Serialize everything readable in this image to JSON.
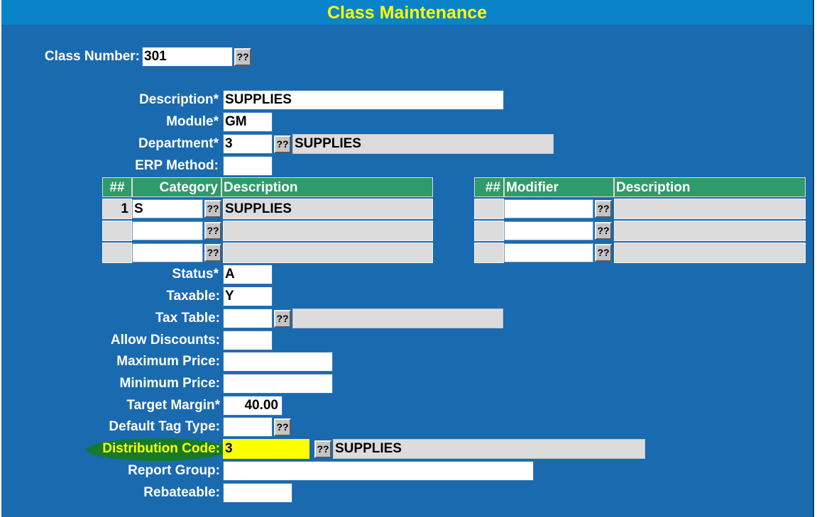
{
  "title": "Class Maintenance",
  "lookup_label": "??",
  "class_number": {
    "label": "Class Number:",
    "value": "301"
  },
  "description": {
    "label": "Description*",
    "value": "SUPPLIES"
  },
  "module": {
    "label": "Module*",
    "value": "GM"
  },
  "department": {
    "label": "Department*",
    "value": "3",
    "desc": "SUPPLIES"
  },
  "erp_method": {
    "label": "ERP Method:",
    "value": ""
  },
  "category_table": {
    "headers": {
      "num": "##",
      "category": "Category",
      "description": "Description"
    },
    "rows": [
      {
        "num": "1",
        "category": "S",
        "description": "SUPPLIES"
      },
      {
        "num": "",
        "category": "",
        "description": ""
      },
      {
        "num": "",
        "category": "",
        "description": ""
      }
    ]
  },
  "modifier_table": {
    "headers": {
      "num": "##",
      "modifier": "Modifier",
      "description": "Description"
    },
    "rows": [
      {
        "num": "",
        "modifier": "",
        "description": ""
      },
      {
        "num": "",
        "modifier": "",
        "description": ""
      },
      {
        "num": "",
        "modifier": "",
        "description": ""
      }
    ]
  },
  "status": {
    "label": "Status*",
    "value": "A"
  },
  "taxable": {
    "label": "Taxable:",
    "value": "Y"
  },
  "tax_table": {
    "label": "Tax Table:",
    "value": "",
    "desc": ""
  },
  "allow_discounts": {
    "label": "Allow Discounts:",
    "value": ""
  },
  "maximum_price": {
    "label": "Maximum Price:",
    "value": ""
  },
  "minimum_price": {
    "label": "Minimum Price:",
    "value": ""
  },
  "target_margin": {
    "label": "Target Margin*",
    "value": "40.00"
  },
  "default_tag_type": {
    "label": "Default Tag Type:",
    "value": ""
  },
  "distribution_code": {
    "label": "Distribution Code:",
    "value": "3",
    "desc": "SUPPLIES"
  },
  "report_group": {
    "label": "Report Group:",
    "value": ""
  },
  "rebateable": {
    "label": "Rebateable:",
    "value": ""
  },
  "colors": {
    "background": "#1a6ab0",
    "titlebar": "#0a83c8",
    "title_text": "#ffff00",
    "table_header": "#2e9b6a",
    "highlight": "#ffff00",
    "highlight_oval": "#167a2c"
  }
}
